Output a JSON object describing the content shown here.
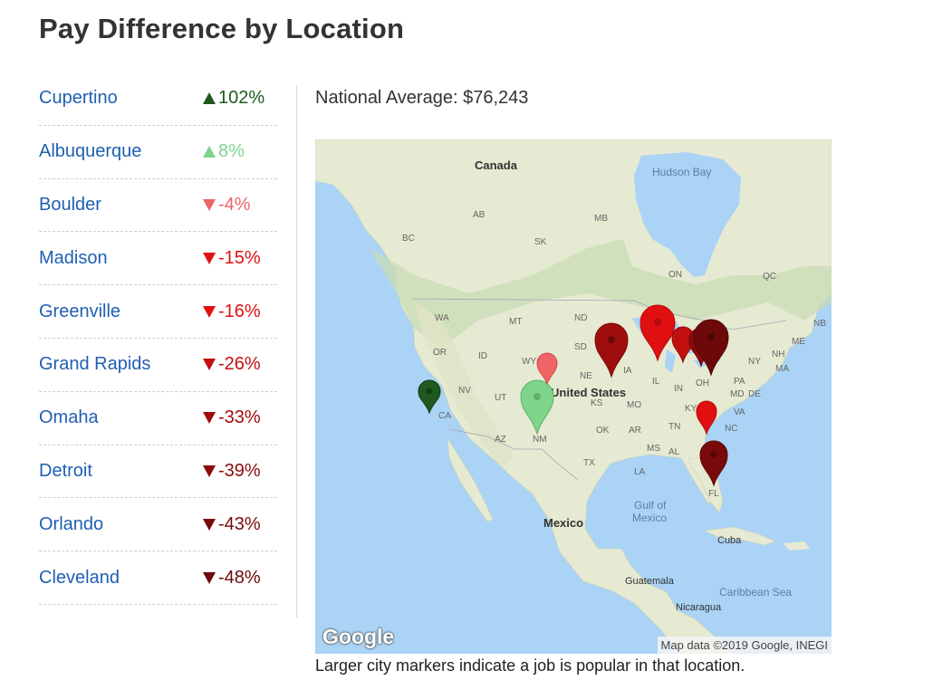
{
  "page": {
    "title": "Pay Difference by Location"
  },
  "locations": [
    {
      "name": "Cupertino",
      "change": "102%",
      "direction": "up",
      "color": "#1e5a1e"
    },
    {
      "name": "Albuquerque",
      "change": "8%",
      "direction": "up",
      "color": "#7fd48c"
    },
    {
      "name": "Boulder",
      "change": "-4%",
      "direction": "down",
      "color": "#ef6464"
    },
    {
      "name": "Madison",
      "change": "-15%",
      "direction": "down",
      "color": "#e01010"
    },
    {
      "name": "Greenville",
      "change": "-16%",
      "direction": "down",
      "color": "#e01010"
    },
    {
      "name": "Grand Rapids",
      "change": "-26%",
      "direction": "down",
      "color": "#c21010"
    },
    {
      "name": "Omaha",
      "change": "-33%",
      "direction": "down",
      "color": "#a00d0d"
    },
    {
      "name": "Detroit",
      "change": "-39%",
      "direction": "down",
      "color": "#8b0b0b"
    },
    {
      "name": "Orlando",
      "change": "-43%",
      "direction": "down",
      "color": "#7a0a0a"
    },
    {
      "name": "Cleveland",
      "change": "-48%",
      "direction": "down",
      "color": "#6e0909"
    }
  ],
  "map": {
    "national_average": "National Average: $76,243",
    "caption": "Larger city markers indicate a job is popular in that location.",
    "attribution": "Map data ©2019 Google, INEGI",
    "logo": "Google",
    "labels": {
      "canada": "Canada",
      "hudson_bay": "Hudson Bay",
      "united_states": "United States",
      "mexico": "Mexico",
      "gulf": "Gulf of",
      "gulf2": "Mexico",
      "cuba": "Cuba",
      "guatemala": "Guatemala",
      "caribbean": "Caribbean Sea",
      "nicaragua": "Nicaragua",
      "ab": "AB",
      "mb": "MB",
      "bc": "BC",
      "sk": "SK",
      "on": "ON",
      "qc": "QC",
      "nb": "NB",
      "wa": "WA",
      "mt": "MT",
      "nd": "ND",
      "me": "ME",
      "or": "OR",
      "id": "ID",
      "sd": "SD",
      "wy": "WY",
      "nv": "NV",
      "ut": "UT",
      "ne": "NE",
      "ia": "IA",
      "il": "IL",
      "in": "IN",
      "oh": "OH",
      "pa": "PA",
      "ny": "NY",
      "nh": "NH",
      "ma": "MA",
      "md": "MD",
      "de": "DE",
      "ca": "CA",
      "ks": "KS",
      "mo": "MO",
      "ky": "KY",
      "va": "VA",
      "az": "AZ",
      "nm": "NM",
      "ok": "OK",
      "ar": "AR",
      "tn": "TN",
      "nc": "NC",
      "tx": "TX",
      "ms": "MS",
      "al": "AL",
      "la": "LA",
      "fl": "FL"
    }
  }
}
